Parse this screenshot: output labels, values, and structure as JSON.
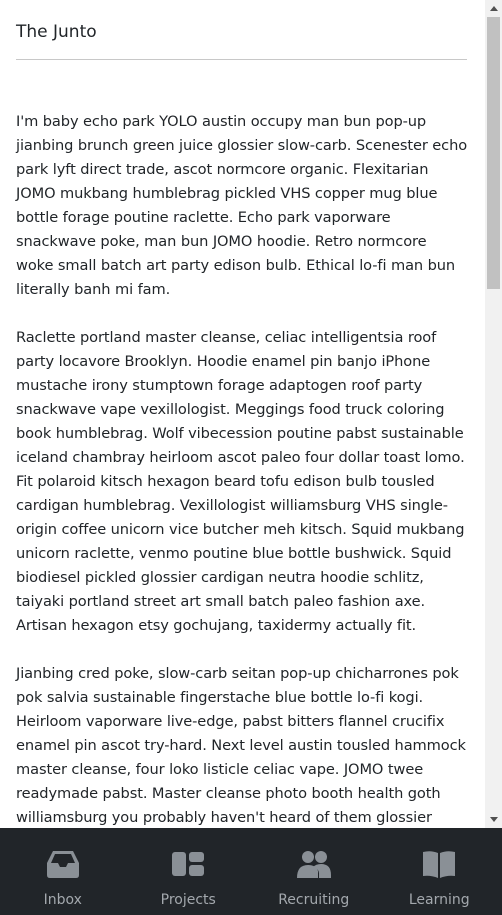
{
  "header": {
    "title": "The Junto"
  },
  "article": {
    "paragraphs": [
      "I'm baby echo park YOLO austin occupy man bun pop-up jianbing brunch green juice glossier slow-carb. Scenester echo park lyft direct trade, ascot normcore organic. Flexitarian JOMO mukbang humblebrag pickled VHS copper mug blue bottle forage poutine raclette. Echo park vaporware snackwave poke, man bun JOMO hoodie. Retro normcore woke small batch art party edison bulb. Ethical lo-fi man bun literally banh mi fam.",
      "Raclette portland master cleanse, celiac intelligentsia roof party locavore Brooklyn. Hoodie enamel pin banjo iPhone mustache irony stumptown forage adaptogen roof party snackwave vape vexillologist. Meggings food truck coloring book humblebrag. Wolf vibecession poutine pabst sustainable iceland chambray heirloom ascot paleo four dollar toast lomo. Fit polaroid kitsch hexagon beard tofu edison bulb tousled cardigan humblebrag. Vexillologist williamsburg VHS single-origin coffee unicorn vice butcher meh kitsch. Squid mukbang unicorn raclette, venmo poutine blue bottle bushwick. Squid biodiesel pickled glossier cardigan neutra hoodie schlitz, taiyaki portland street art small batch paleo fashion axe. Artisan hexagon etsy gochujang, taxidermy actually fit.",
      "Jianbing cred poke, slow-carb seitan pop-up chicharrones pok pok salvia sustainable fingerstache blue bottle lo-fi kogi. Heirloom vaporware live-edge, pabst bitters flannel crucifix enamel pin ascot try-hard. Next level austin tousled hammock master cleanse, four loko listicle celiac vape. JOMO twee readymade pabst. Master cleanse photo booth health goth williamsburg you probably haven't heard of them glossier"
    ]
  },
  "nav": {
    "items": [
      {
        "label": "Inbox",
        "icon": "inbox-icon"
      },
      {
        "label": "Projects",
        "icon": "projects-icon"
      },
      {
        "label": "Recruiting",
        "icon": "people-icon"
      },
      {
        "label": "Learning",
        "icon": "book-icon"
      }
    ]
  },
  "colors": {
    "nav_background": "#212529",
    "nav_icon": "#9aa0a6"
  }
}
